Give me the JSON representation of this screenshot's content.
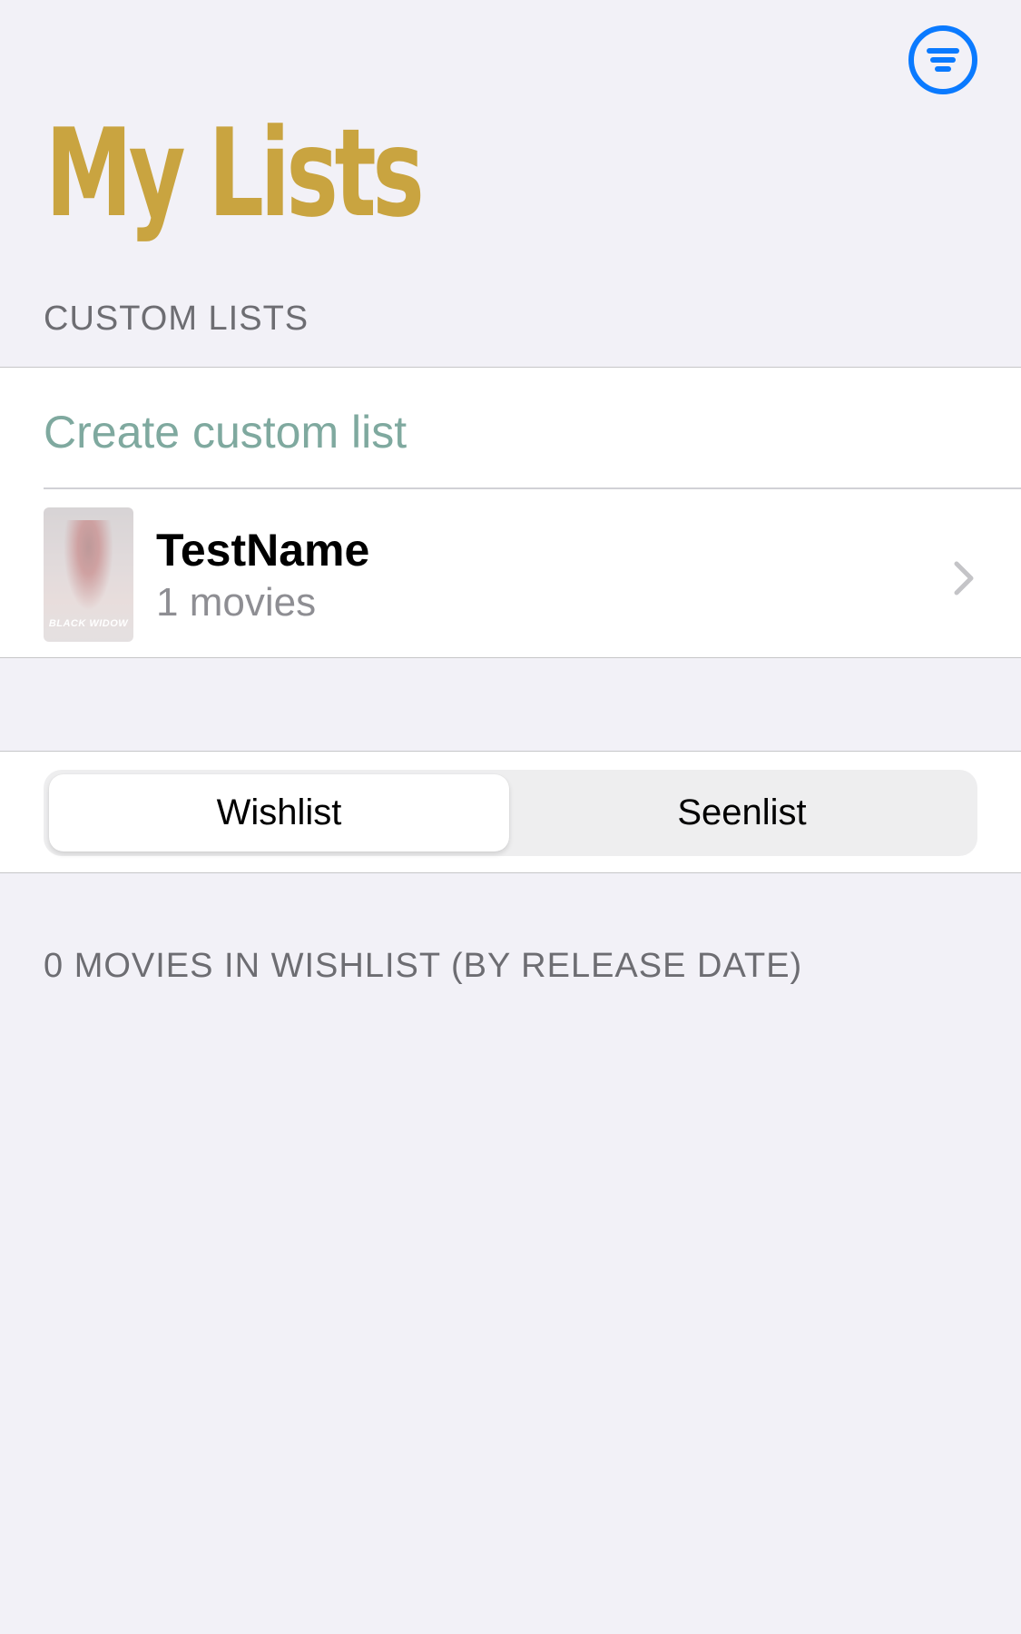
{
  "header": {
    "title": "My Lists",
    "filter_icon": "filter-circle-icon",
    "accent_color": "#0a7aff",
    "title_color": "#c9a440"
  },
  "custom_lists": {
    "section_label": "CUSTOM LISTS",
    "create_label": "Create custom list",
    "items": [
      {
        "name": "TestName",
        "count": "1 movies",
        "poster_title": "BLACK WIDOW"
      }
    ]
  },
  "segment": {
    "options": [
      "Wishlist",
      "Seenlist"
    ],
    "selected": "Wishlist"
  },
  "wishlist": {
    "section_label": "0 MOVIES IN WISHLIST (BY RELEASE DATE)"
  }
}
